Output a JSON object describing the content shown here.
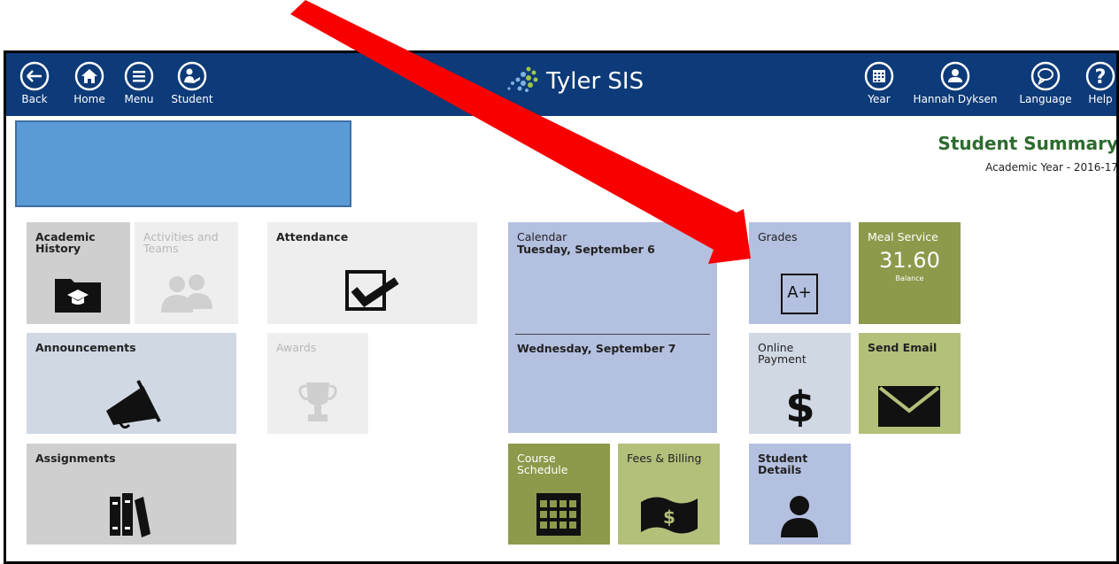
{
  "topbar": {
    "back_label": "Back",
    "home_label": "Home",
    "menu_label": "Menu",
    "student_label": "Student",
    "brand": "Tyler SIS",
    "year_label": "Year",
    "user_label": "Hannah Dyksen",
    "language_label": "Language",
    "help_label": "Help",
    "bg_color": "#0d3a78"
  },
  "summary": {
    "title": "Student Summary",
    "subtitle": "Academic Year - 2016-17"
  },
  "tiles": {
    "academic_history": "Academic History",
    "activities": "Activities and Teams",
    "attendance": "Attendance",
    "calendar": "Calendar",
    "calendar_day1": "Tuesday, September 6",
    "calendar_day2": "Wednesday, September 7",
    "grades": "Grades",
    "grades_icon_text": "A+",
    "meal_service": "Meal Service",
    "meal_balance_value": "31.60",
    "meal_balance_label": "Balance",
    "announcements": "Announcements",
    "awards": "Awards",
    "online_payment": "Online Payment",
    "send_email": "Send Email",
    "assignments": "Assignments",
    "course_schedule": "Course Schedule",
    "fees_billing": "Fees & Billing",
    "student_details": "Student Details"
  },
  "annotation": {
    "arrow_color": "#ff0000"
  }
}
